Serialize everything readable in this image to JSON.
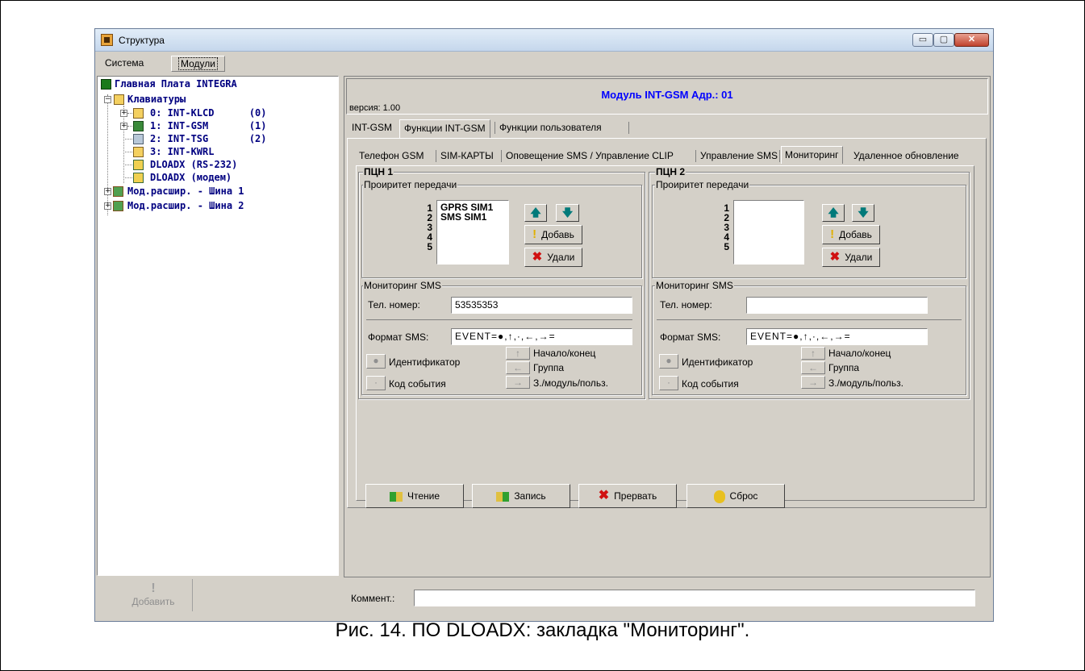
{
  "window": {
    "title": "Структура",
    "controls": {
      "minimize": "▭",
      "maximize": "▢",
      "close": "✕"
    }
  },
  "top_tabs": [
    "Система",
    "Модули"
  ],
  "tree": [
    {
      "label": "Главная Плата INTEGRA",
      "icon": "mainboard-icon"
    },
    {
      "label": "Клавиатуры",
      "icon": "keyboard-icon"
    },
    {
      "label": "0: INT-KLCD      (0)",
      "icon": "keypad-icon"
    },
    {
      "label": "1: INT-GSM       (1)",
      "icon": "gsm-module-icon"
    },
    {
      "label": "2: INT-TSG       (2)",
      "icon": "tsg-icon"
    },
    {
      "label": "3: INT-KWRL",
      "icon": "keypad-icon"
    },
    {
      "label": "DLOADX (RS-232)",
      "icon": "computer-icon"
    },
    {
      "label": "DLOADX (модем)",
      "icon": "computer-icon"
    },
    {
      "label": "Мод.расшир. - Шина 1",
      "icon": "expander-icon"
    },
    {
      "label": "Мод.расшир. - Шина 2",
      "icon": "expander-icon"
    }
  ],
  "add_button": {
    "label": "Добавить",
    "icon": "exclamation-icon"
  },
  "module": {
    "title": "Модуль INT-GSM Адр.: 01",
    "version": "версия: 1.00"
  },
  "tabs_level1": [
    "INT-GSM",
    "Функции INT-GSM",
    "Функции пользователя"
  ],
  "tabs_level2": [
    "Телефон GSM",
    "SIM-КАРТЫ",
    "Оповещение SMS / Управление CLIP",
    "Управление SMS",
    "Мониторинг",
    "Удаленное обновление"
  ],
  "pstn1": {
    "title": "ПЦН 1",
    "priority_title": "Проиритет передачи",
    "numbers": [
      "1",
      "2",
      "3",
      "4",
      "5"
    ],
    "items": [
      "GPRS SIM1",
      "SMS SIM1"
    ],
    "sms_title": "Мониторинг SMS",
    "phone_label": "Тел. номер:",
    "phone_value": "53535353",
    "format_label": "Формат SMS:",
    "format_value": "EVENT=●,↑,·,←,→="
  },
  "pstn2": {
    "title": "ПЦН 2",
    "priority_title": "Проиритет передачи",
    "numbers": [
      "1",
      "2",
      "3",
      "4",
      "5"
    ],
    "items": [],
    "sms_title": "Мониторинг SMS",
    "phone_label": "Тел. номер:",
    "phone_value": "",
    "format_label": "Формат SMS:",
    "format_value": "EVENT=●,↑,·,←,→="
  },
  "buttons": {
    "add": "Добавь",
    "delete": "Удали",
    "up": "🡅",
    "down": "🡇"
  },
  "format_buttons": {
    "identifier": "Идентификатор",
    "event_code": "Код события",
    "begin_end": "Начало/конец",
    "group": "Группа",
    "zone_module_user": "З./модуль/польз."
  },
  "bottom_buttons": {
    "read": "Чтение",
    "write": "Запись",
    "abort": "Прервать",
    "reset": "Сброс"
  },
  "comment_label": "Коммент.:",
  "caption": "Рис. 14. ПО DLOADX: закладка \"Мониторинг\".",
  "colors": {
    "title_blue": "#0000ff",
    "tree_navy": "#000080",
    "accent_teal": "#007a7a",
    "delete_red": "#d01010"
  }
}
